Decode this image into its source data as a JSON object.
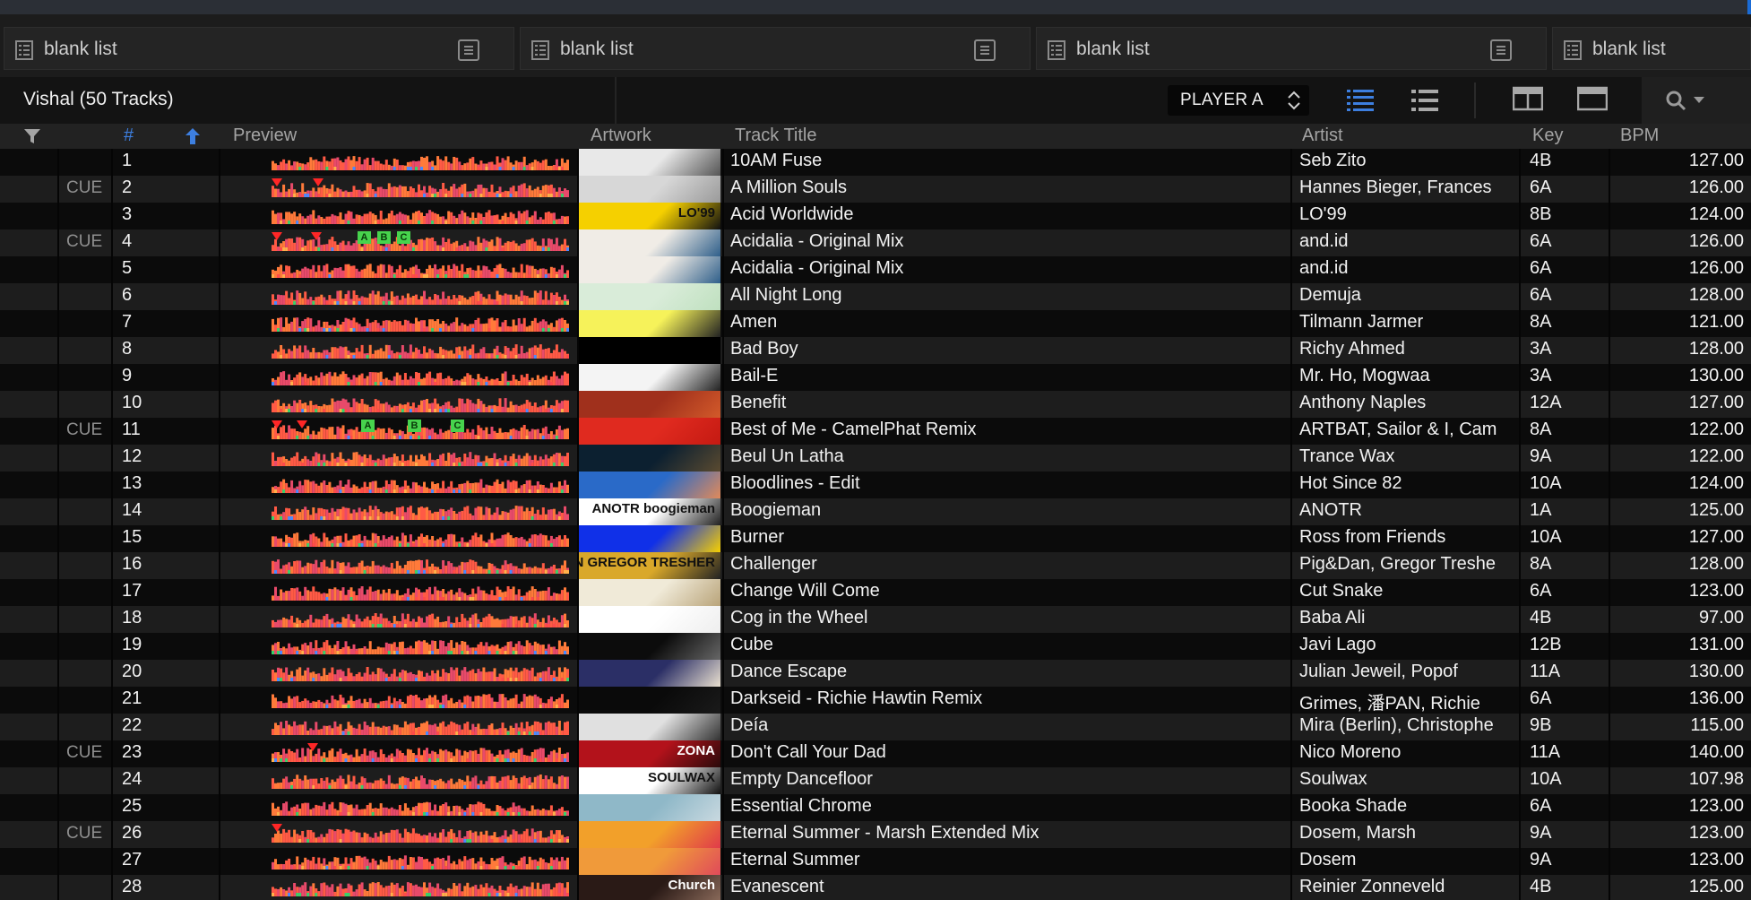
{
  "tabs": [
    {
      "label": "blank list"
    },
    {
      "label": "blank list"
    },
    {
      "label": "blank list"
    },
    {
      "label": "blank list"
    }
  ],
  "toolbar": {
    "title": "Vishal (50 Tracks)",
    "player": "PLAYER A",
    "icons": [
      "list-detail-icon",
      "list-simple-icon",
      "layout-split-icon",
      "layout-single-icon",
      "search-icon"
    ],
    "accent": "#3d7fe0"
  },
  "columns": {
    "num": "#",
    "preview": "Preview",
    "artwork": "Artwork",
    "title": "Track Title",
    "artist": "Artist",
    "key": "Key",
    "bpm": "BPM"
  },
  "tracks": [
    {
      "cue": "",
      "num": "1",
      "title": "10AM Fuse",
      "artist": "Seb Zito",
      "key": "4B",
      "bpm": "127.00"
    },
    {
      "cue": "CUE",
      "num": "2",
      "title": "A Million Souls",
      "artist": "Hannes Bieger, Frances",
      "key": "6A",
      "bpm": "126.00"
    },
    {
      "cue": "",
      "num": "3",
      "title": "Acid Worldwide",
      "artist": "LO'99",
      "key": "8B",
      "bpm": "124.00",
      "art_text": "LO'99"
    },
    {
      "cue": "CUE",
      "num": "4",
      "title": "Acidalia - Original Mix",
      "artist": "and.id",
      "key": "6A",
      "bpm": "126.00"
    },
    {
      "cue": "",
      "num": "5",
      "title": "Acidalia - Original Mix",
      "artist": "and.id",
      "key": "6A",
      "bpm": "126.00"
    },
    {
      "cue": "",
      "num": "6",
      "title": "All Night Long",
      "artist": "Demuja",
      "key": "6A",
      "bpm": "128.00"
    },
    {
      "cue": "",
      "num": "7",
      "title": "Amen",
      "artist": "Tilmann Jarmer",
      "key": "8A",
      "bpm": "121.00"
    },
    {
      "cue": "",
      "num": "8",
      "title": "Bad Boy",
      "artist": "Richy Ahmed",
      "key": "3A",
      "bpm": "128.00"
    },
    {
      "cue": "",
      "num": "9",
      "title": "Bail-E",
      "artist": "Mr. Ho, Mogwaa",
      "key": "3A",
      "bpm": "130.00"
    },
    {
      "cue": "",
      "num": "10",
      "title": "Benefit",
      "artist": "Anthony Naples",
      "key": "12A",
      "bpm": "127.00"
    },
    {
      "cue": "CUE",
      "num": "11",
      "title": "Best of Me - CamelPhat Remix",
      "artist": "ARTBAT, Sailor & I, Cam",
      "key": "8A",
      "bpm": "122.00"
    },
    {
      "cue": "",
      "num": "12",
      "title": "Beul Un Latha",
      "artist": "Trance Wax",
      "key": "9A",
      "bpm": "122.00"
    },
    {
      "cue": "",
      "num": "13",
      "title": "Bloodlines - Edit",
      "artist": "Hot Since 82",
      "key": "10A",
      "bpm": "124.00"
    },
    {
      "cue": "",
      "num": "14",
      "title": "Boogieman",
      "artist": "ANOTR",
      "key": "1A",
      "bpm": "125.00",
      "art_text": "ANOTR boogieman"
    },
    {
      "cue": "",
      "num": "15",
      "title": "Burner",
      "artist": "Ross from Friends",
      "key": "10A",
      "bpm": "127.00"
    },
    {
      "cue": "",
      "num": "16",
      "title": "Challenger",
      "artist": "Pig&Dan, Gregor Treshe",
      "key": "8A",
      "bpm": "128.00",
      "art_text": "PIG&DAN GREGOR TRESHER"
    },
    {
      "cue": "",
      "num": "17",
      "title": "Change Will Come",
      "artist": "Cut Snake",
      "key": "6A",
      "bpm": "123.00"
    },
    {
      "cue": "",
      "num": "18",
      "title": "Cog in the Wheel",
      "artist": "Baba Ali",
      "key": "4B",
      "bpm": "97.00"
    },
    {
      "cue": "",
      "num": "19",
      "title": "Cube",
      "artist": "Javi Lago",
      "key": "12B",
      "bpm": "131.00"
    },
    {
      "cue": "",
      "num": "20",
      "title": "Dance Escape",
      "artist": "Julian Jeweil, Popof",
      "key": "11A",
      "bpm": "130.00"
    },
    {
      "cue": "",
      "num": "21",
      "title": "Darkseid - Richie Hawtin Remix",
      "artist": "Grimes, 潘PAN, Richie",
      "key": "6A",
      "bpm": "136.00"
    },
    {
      "cue": "",
      "num": "22",
      "title": "Deía",
      "artist": "Mira (Berlin), Christophe",
      "key": "9B",
      "bpm": "115.00"
    },
    {
      "cue": "CUE",
      "num": "23",
      "title": "Don't Call Your Dad",
      "artist": "Nico Moreno",
      "key": "11A",
      "bpm": "140.00",
      "art_text": "ZONA"
    },
    {
      "cue": "",
      "num": "24",
      "title": "Empty Dancefloor",
      "artist": "Soulwax",
      "key": "10A",
      "bpm": "107.98",
      "art_text": "SOULWAX"
    },
    {
      "cue": "",
      "num": "25",
      "title": "Essential Chrome",
      "artist": "Booka Shade",
      "key": "6A",
      "bpm": "123.00"
    },
    {
      "cue": "CUE",
      "num": "26",
      "title": "Eternal Summer - Marsh Extended Mix",
      "artist": "Dosem, Marsh",
      "key": "9A",
      "bpm": "123.00"
    },
    {
      "cue": "",
      "num": "27",
      "title": "Eternal Summer",
      "artist": "Dosem",
      "key": "9A",
      "bpm": "123.00"
    },
    {
      "cue": "",
      "num": "28",
      "title": "Evanescent",
      "artist": "Reinier Zonneveld",
      "key": "4B",
      "bpm": "125.00",
      "art_text": "Church"
    }
  ]
}
